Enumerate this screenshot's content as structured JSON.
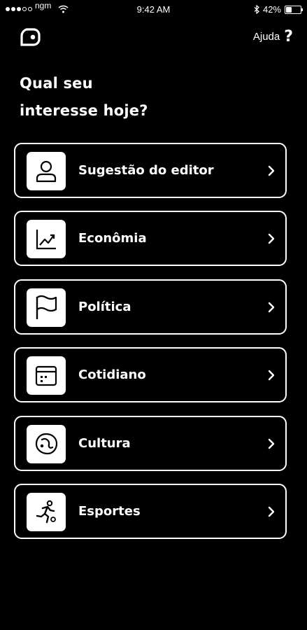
{
  "status_bar": {
    "carrier": "ngm",
    "time": "9:42 AM",
    "battery": "42%",
    "battery_level": 0.42,
    "signal_bars_filled": 3,
    "signal_bars_total": 5
  },
  "header": {
    "logo_icon": "app-logo-icon",
    "help_label": "Ajuda",
    "help_icon": "?"
  },
  "title": {
    "line1": "Qual seu",
    "line2": "interesse hoje?"
  },
  "categories": [
    {
      "label": "Sugestão do editor",
      "icon": "user-icon"
    },
    {
      "label": "Econômia",
      "icon": "chart-icon"
    },
    {
      "label": "Política",
      "icon": "flag-icon"
    },
    {
      "label": "Cotidiano",
      "icon": "calendar-icon"
    },
    {
      "label": "Cultura",
      "icon": "palette-icon"
    },
    {
      "label": "Esportes",
      "icon": "runner-icon"
    }
  ],
  "colors": {
    "background": "#000000",
    "foreground": "#ffffff"
  }
}
